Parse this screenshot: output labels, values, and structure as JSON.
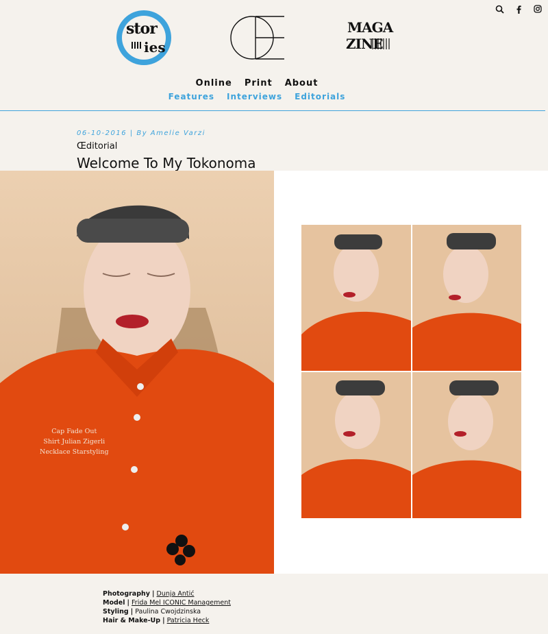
{
  "header": {
    "nav_primary": [
      "Online",
      "Print",
      "About"
    ],
    "nav_secondary": [
      "Features",
      "Interviews",
      "Editorials"
    ],
    "icons": [
      "search-icon",
      "facebook-icon",
      "instagram-icon"
    ],
    "logos": {
      "left": {
        "line1": "stor",
        "line2": "ies"
      },
      "right": {
        "line1": "MAGA",
        "line2": "ZINE"
      }
    }
  },
  "article": {
    "meta": "06-10-2016 | By Amelie Varzi",
    "category": "Œditorial",
    "title": "Welcome To My Tokonoma"
  },
  "caption": [
    "Cap Fade Out",
    "Shirt Julian Zigerli",
    "Necklace Starstyling"
  ],
  "credits": [
    {
      "label": "Photography",
      "value": "Dunja Antić"
    },
    {
      "label": "Model",
      "value": "Frida Mel ICONIC Management"
    },
    {
      "label": "Styling",
      "value": "Paulina Cwojdzinska"
    },
    {
      "label": "Hair & Make-Up",
      "value": "Patricia Heck"
    }
  ],
  "colors": {
    "accent": "#3ea3dc",
    "background": "#f5f2ed",
    "shirt": "#e14a10"
  }
}
